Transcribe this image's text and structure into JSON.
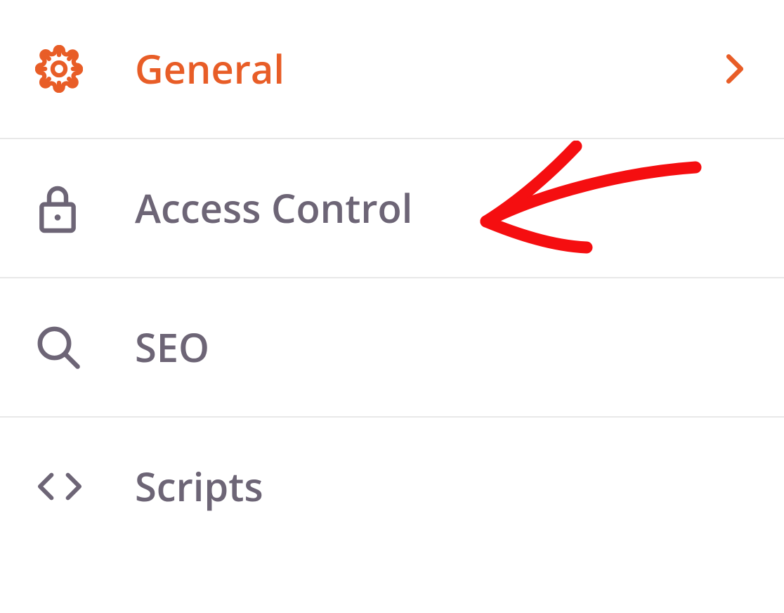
{
  "menu": {
    "items": [
      {
        "label": "General",
        "icon": "gear-icon",
        "active": true,
        "hasChevron": true
      },
      {
        "label": "Access Control",
        "icon": "lock-icon",
        "active": false,
        "hasChevron": false
      },
      {
        "label": "SEO",
        "icon": "search-icon",
        "active": false,
        "hasChevron": false
      },
      {
        "label": "Scripts",
        "icon": "code-icon",
        "active": false,
        "hasChevron": false
      }
    ]
  },
  "colors": {
    "accent": "#e85d27",
    "text": "#6d6576",
    "border": "#e8e8e8",
    "annotation": "#f50e10"
  }
}
